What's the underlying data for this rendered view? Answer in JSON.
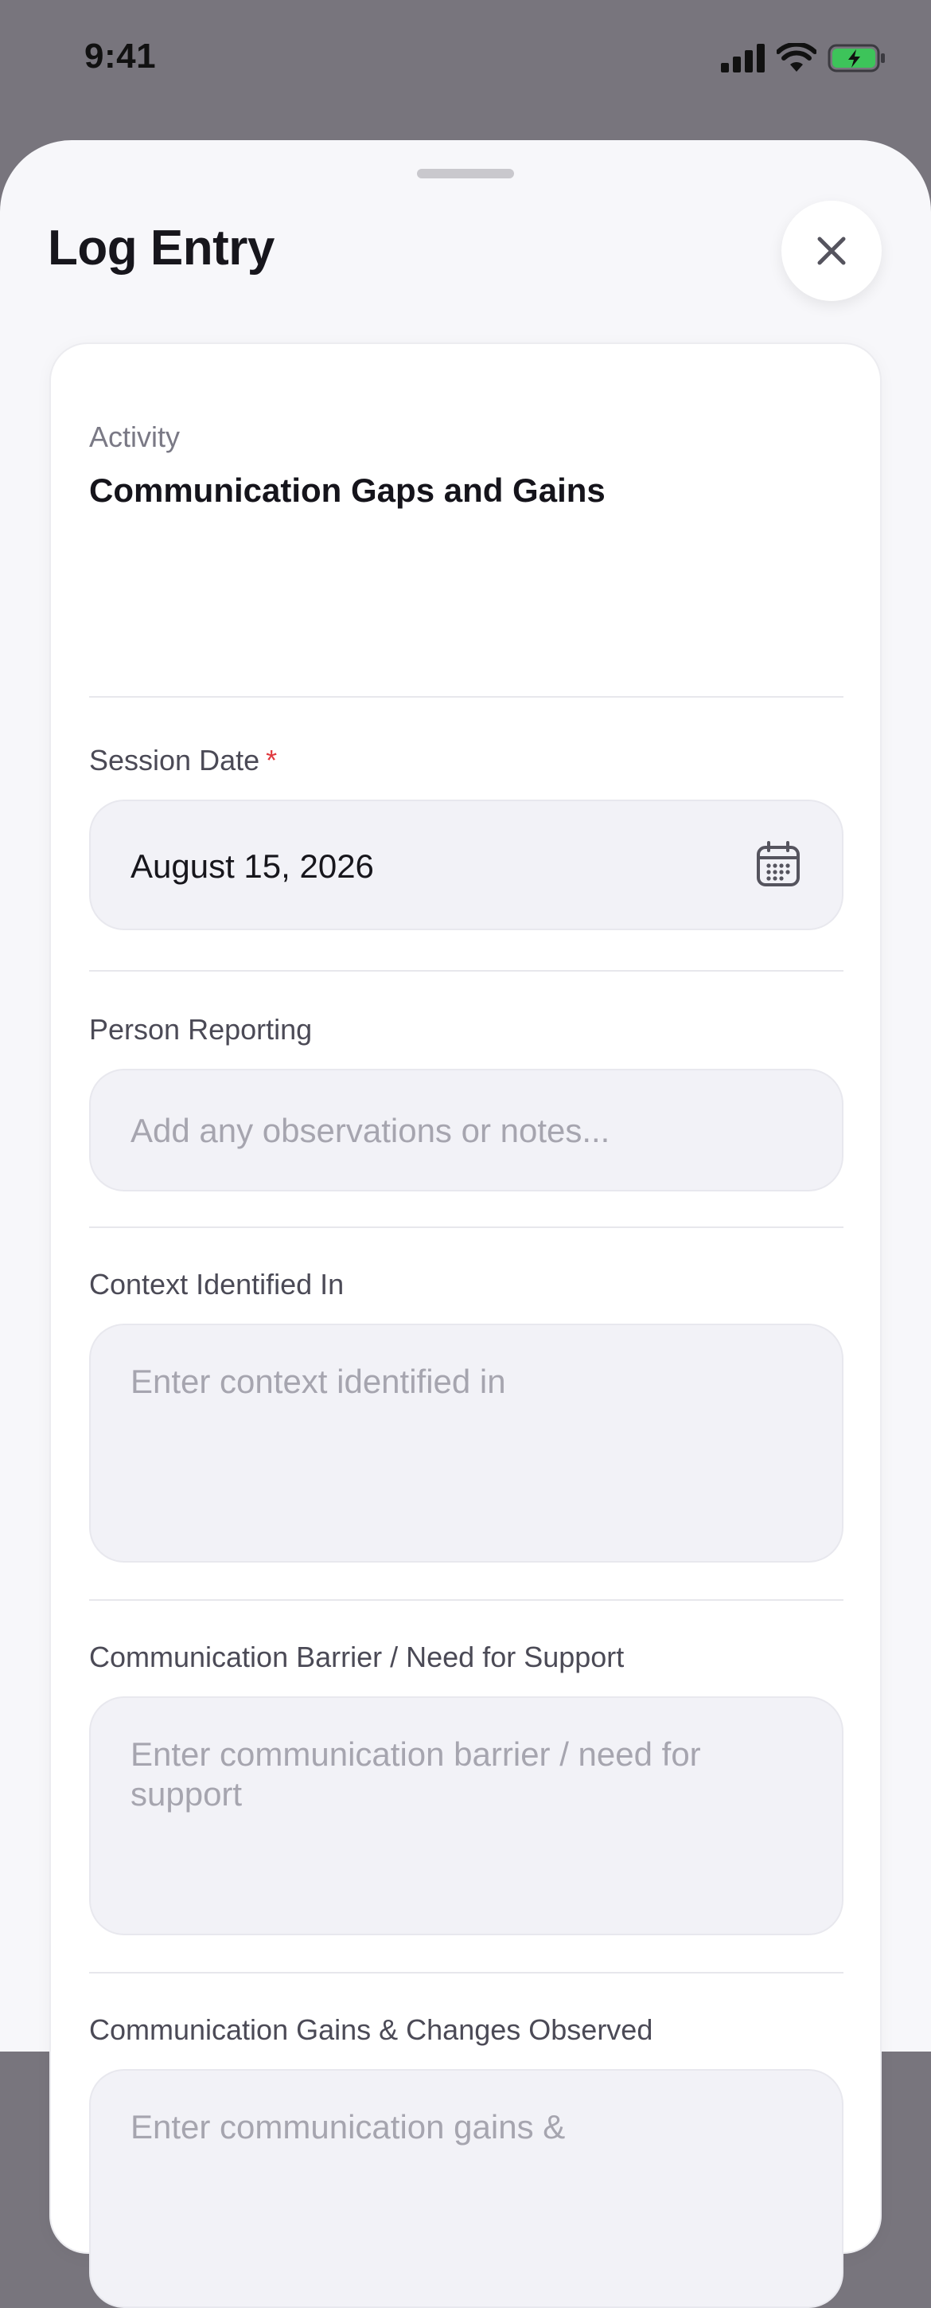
{
  "status_bar": {
    "time": "9:41"
  },
  "sheet": {
    "title": "Log Entry"
  },
  "activity": {
    "label": "Activity",
    "value": "Communication Gaps and Gains"
  },
  "session_date": {
    "label": "Session Date",
    "required_marker": "*",
    "value": "August 15, 2026"
  },
  "person_reporting": {
    "label": "Person Reporting",
    "placeholder": "Add any observations or notes..."
  },
  "context": {
    "label": "Context Identified In",
    "placeholder": "Enter context identified in"
  },
  "barrier": {
    "label": "Communication Barrier / Need for Support",
    "placeholder": "Enter communication barrier / need for support"
  },
  "gains": {
    "label": "Communication Gains & Changes Observed",
    "placeholder": "Enter communication gains &"
  },
  "colors": {
    "required": "#e0393e",
    "battery": "#3dc45a"
  }
}
